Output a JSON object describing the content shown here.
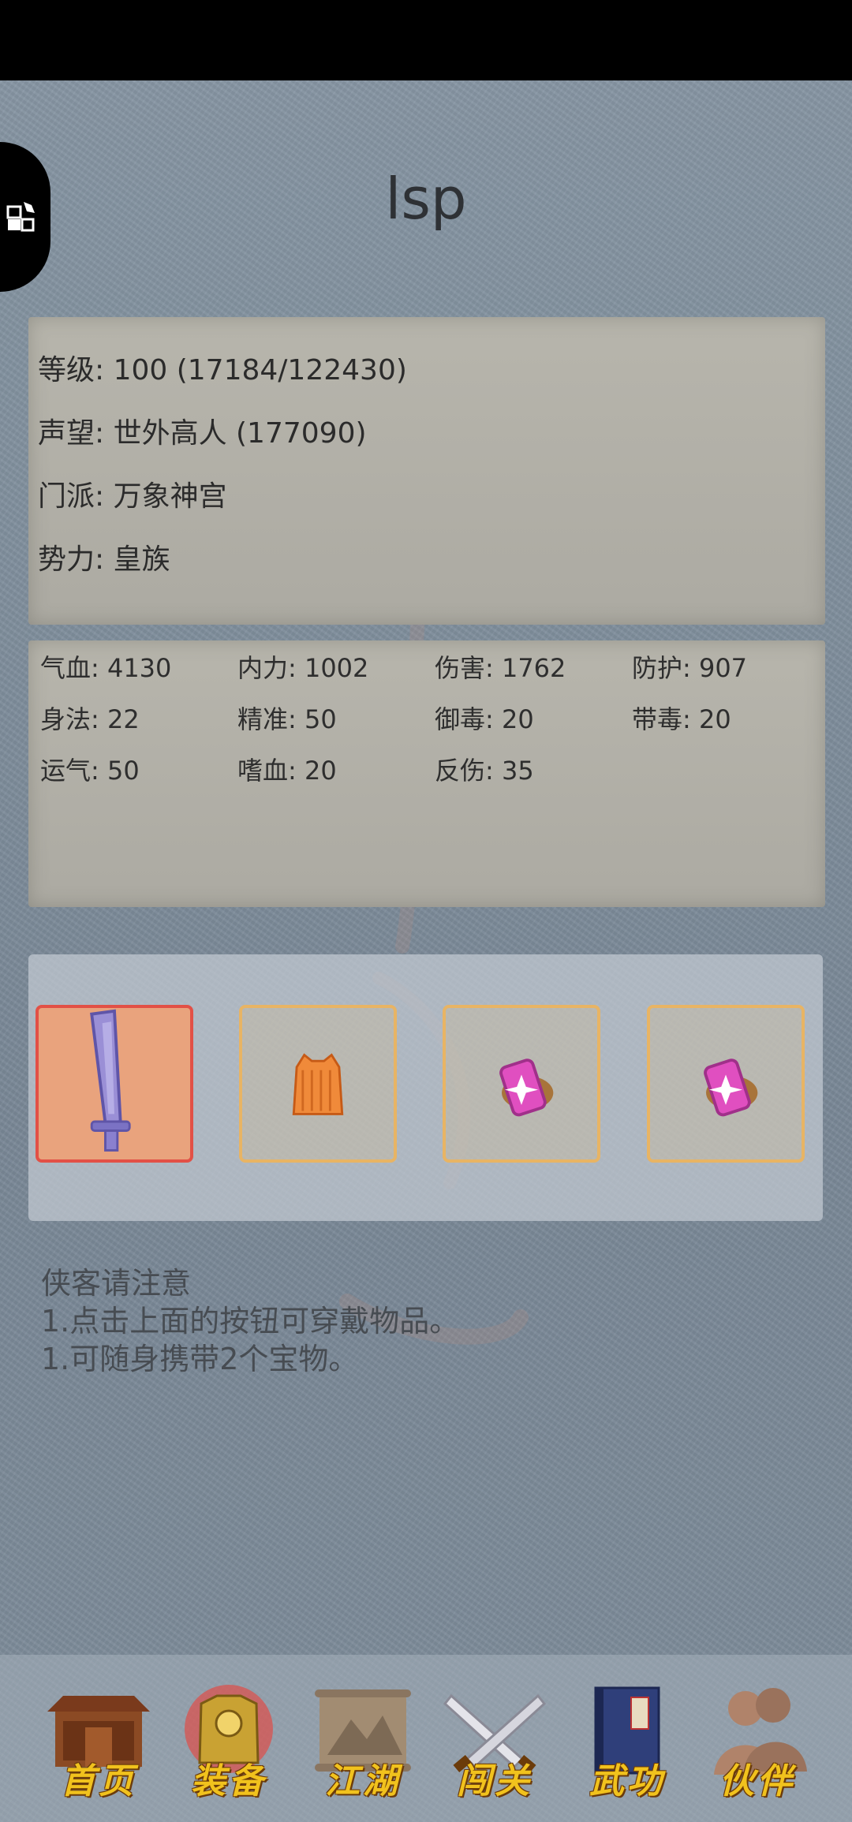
{
  "header": {
    "title": "lsp"
  },
  "profile": {
    "level": "等级: 100 (17184/122430)",
    "reputation": "声望: 世外高人 (177090)",
    "sect": "门派: 万象神宫",
    "faction": "势力:  皇族"
  },
  "stats": [
    [
      "气血: 4130",
      "内力: 1002",
      "伤害: 1762",
      "防护: 907"
    ],
    [
      "身法: 22",
      "精准: 50",
      "御毒: 20",
      "带毒: 20"
    ],
    [
      "运气: 50",
      "嗜血: 20",
      "反伤: 35"
    ]
  ],
  "equipment": {
    "slots": [
      {
        "item_icon": "sword-icon",
        "selected": true
      },
      {
        "item_icon": "armor-icon",
        "selected": false
      },
      {
        "item_icon": "treasure-icon",
        "selected": false
      },
      {
        "item_icon": "treasure-icon",
        "selected": false
      }
    ]
  },
  "notice": {
    "title": "侠客请注意",
    "line1": "1.点击上面的按钮可穿戴物品。",
    "line2": "1.可随身携带2个宝物。"
  },
  "nav": [
    {
      "label": "首页",
      "icon": "house-icon"
    },
    {
      "label": "装备",
      "icon": "armor-icon"
    },
    {
      "label": "江湖",
      "icon": "map-scroll-icon"
    },
    {
      "label": "闯关",
      "icon": "crossed-swords-icon"
    },
    {
      "label": "武功",
      "icon": "book-icon"
    },
    {
      "label": "伙伴",
      "icon": "companions-icon"
    }
  ],
  "colors": {
    "background": "#7f8d9b",
    "panel": "#b2b0a8",
    "slot_border": "#e8b464",
    "selected_border": "#e25046",
    "nav_text": "#f1c21d"
  }
}
